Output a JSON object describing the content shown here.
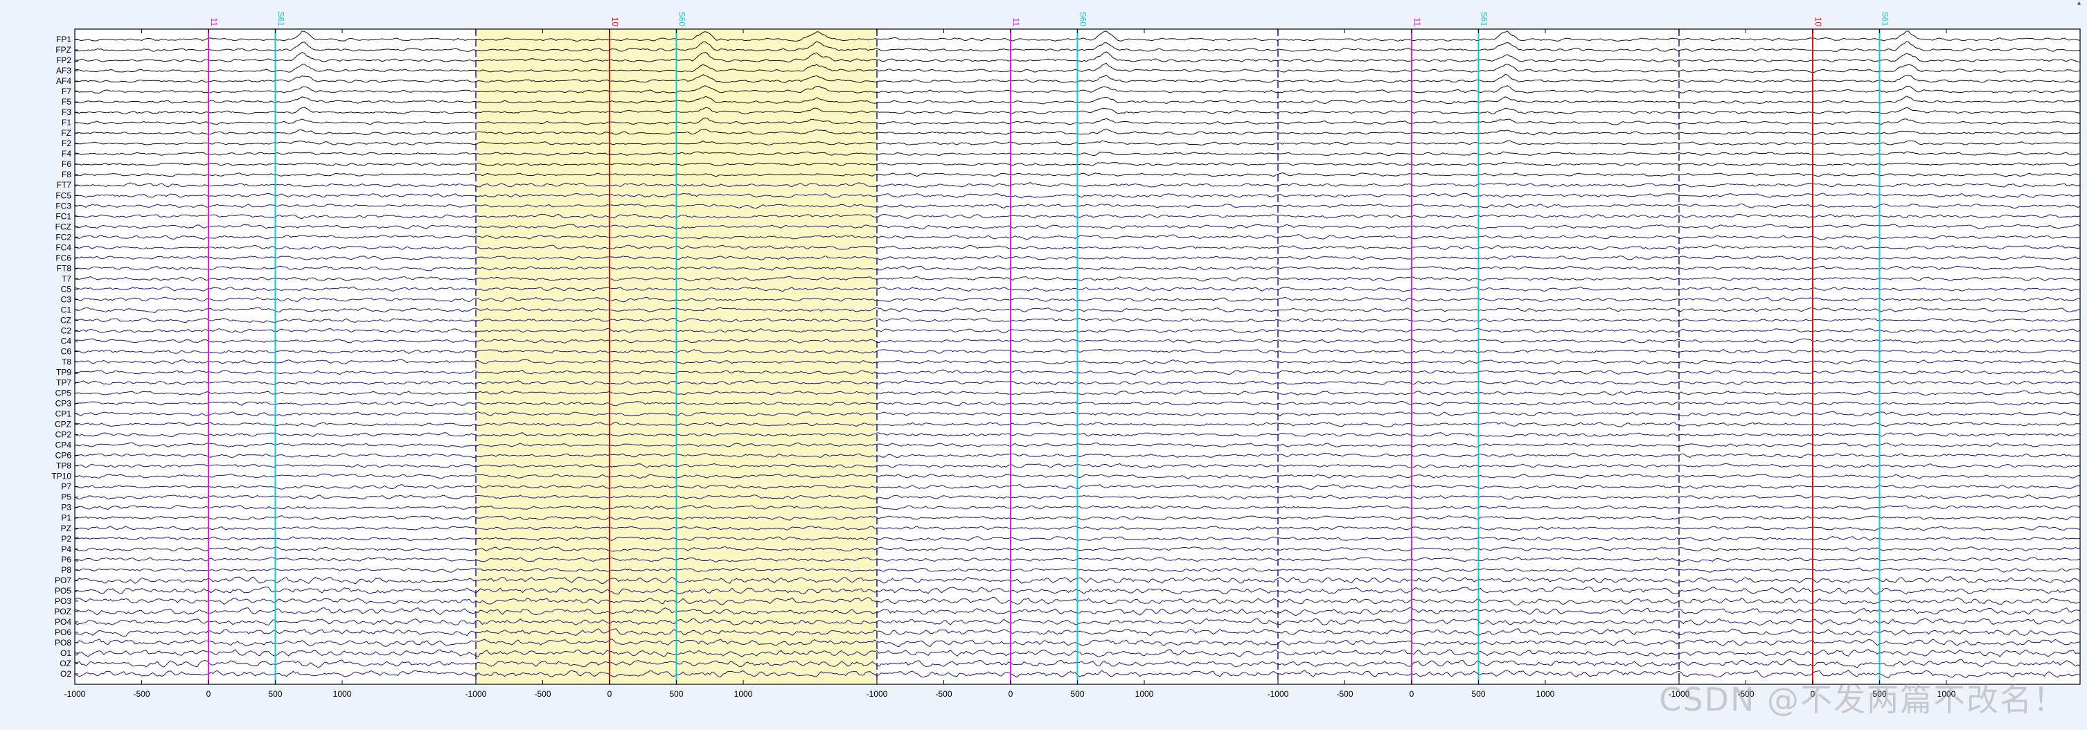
{
  "channels": [
    "FP1",
    "FPZ",
    "FP2",
    "AF3",
    "AF4",
    "F7",
    "F5",
    "F3",
    "F1",
    "FZ",
    "F2",
    "F4",
    "F6",
    "F8",
    "FT7",
    "FC5",
    "FC3",
    "FC1",
    "FCZ",
    "FC2",
    "FC4",
    "FC6",
    "FT8",
    "T7",
    "C5",
    "C3",
    "C1",
    "CZ",
    "C2",
    "C4",
    "C6",
    "T8",
    "TP9",
    "TP7",
    "CP5",
    "CP3",
    "CP1",
    "CPZ",
    "CP2",
    "CP4",
    "CP6",
    "TP8",
    "TP10",
    "P7",
    "P5",
    "P3",
    "P1",
    "PZ",
    "P2",
    "P4",
    "P6",
    "P8",
    "PO7",
    "PO5",
    "PO3",
    "POZ",
    "PO4",
    "PO6",
    "PO8",
    "O1",
    "OZ",
    "O2"
  ],
  "epochs": [
    {
      "events": [
        {
          "label": "11",
          "time": 0,
          "color": "#e020e0"
        },
        {
          "label": "S61",
          "time": 500,
          "color": "#10c8d8"
        }
      ],
      "highlighted": false
    },
    {
      "events": [
        {
          "label": "10",
          "time": 0,
          "color": "#e01010"
        },
        {
          "label": "S60",
          "time": 500,
          "color": "#10c8d8"
        }
      ],
      "highlighted": true
    },
    {
      "events": [
        {
          "label": "11",
          "time": 0,
          "color": "#e020e0"
        },
        {
          "label": "S60",
          "time": 500,
          "color": "#10c8d8"
        }
      ],
      "highlighted": false
    },
    {
      "events": [
        {
          "label": "11",
          "time": 0,
          "color": "#e020e0"
        },
        {
          "label": "S61",
          "time": 500,
          "color": "#10c8d8"
        }
      ],
      "highlighted": false
    },
    {
      "events": [
        {
          "label": "10",
          "time": 0,
          "color": "#e01010"
        },
        {
          "label": "S61",
          "time": 500,
          "color": "#10c8d8"
        }
      ],
      "highlighted": false
    }
  ],
  "time_ticks": [
    [
      "-1000",
      "-500",
      "0",
      "500",
      "1000"
    ],
    [
      "-1000",
      "-500",
      "0",
      "500",
      "1000"
    ],
    [
      "-1000",
      "-500",
      "0",
      "500",
      "1000"
    ],
    [
      "-1000",
      "-500",
      "0",
      "500",
      "1000"
    ],
    [
      "-1000",
      "-500",
      "0",
      "500",
      "1000"
    ]
  ],
  "epoch_time_range_ms": [
    -1000,
    2000
  ],
  "colors": {
    "trace_primary": "#1a1a78",
    "trace_frontal": "#111111",
    "highlight": "#fbf8c4",
    "epoch_divider": "#1a1a9a",
    "axis": "#000000",
    "background": "#ffffff"
  },
  "watermark": "CSDN @不发两篇不改名！"
}
